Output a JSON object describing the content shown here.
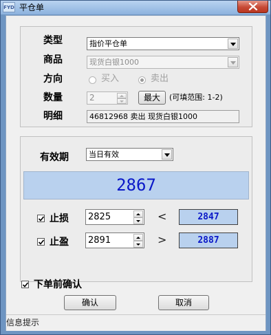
{
  "window": {
    "title": "平仓单",
    "app_icon": "FYD"
  },
  "form": {
    "type_label": "类型",
    "type_value": "指价平仓单",
    "product_label": "商品",
    "product_value": "现货白银1000",
    "direction_label": "方向",
    "buy_label": "买入",
    "sell_label": "卖出",
    "selected_direction": "卖出",
    "qty_label": "数量",
    "qty_value": "2",
    "max_button": "最大",
    "qty_range": "(可填范围: 1-2)",
    "detail_label": "明细",
    "detail_value": "46812968 卖出 现货白银1000"
  },
  "order": {
    "validity_label": "有效期",
    "validity_value": "当日有效",
    "current_price": "2867",
    "stop_loss_label": "止损",
    "stop_loss_checked": true,
    "stop_loss_value": "2825",
    "stop_loss_symbol": "<",
    "stop_loss_ref": "2847",
    "take_profit_label": "止盈",
    "take_profit_checked": true,
    "take_profit_value": "2891",
    "take_profit_symbol": ">",
    "take_profit_ref": "2887"
  },
  "confirm_before_order": {
    "label": "下单前确认",
    "checked": true
  },
  "buttons": {
    "ok": "确认",
    "cancel": "取消"
  },
  "status_text": "信息提示",
  "colors": {
    "price_bg": "#b9d1ee",
    "price_text": "#0a18c8",
    "title_bar": "#8cb2de",
    "close_red": "#c74a36"
  }
}
